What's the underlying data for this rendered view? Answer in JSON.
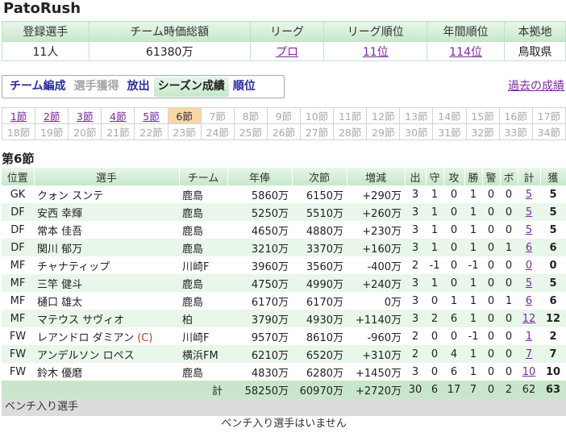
{
  "site_title": "PatoRush",
  "summary": {
    "headers": [
      "登録選手",
      "チーム時価総額",
      "リーグ",
      "リーグ順位",
      "年間順位",
      "本拠地"
    ],
    "players": "11人",
    "value": "61380万",
    "league": "プロ",
    "league_rank": "11位",
    "year_rank": "114位",
    "home": "鳥取県"
  },
  "tabs": [
    "チーム編成",
    "選手獲得",
    "放出",
    "シーズン成績",
    "順位"
  ],
  "past_link": "過去の成績",
  "rounds_row1": [
    "1節",
    "2節",
    "3節",
    "4節",
    "5節",
    "6節",
    "7節",
    "8節",
    "9節",
    "10節",
    "11節",
    "12節",
    "13節",
    "14節",
    "15節",
    "16節",
    "17節"
  ],
  "rounds_row2": [
    "18節",
    "19節",
    "20節",
    "21節",
    "22節",
    "23節",
    "24節",
    "25節",
    "26節",
    "27節",
    "28節",
    "29節",
    "30節",
    "31節",
    "32節",
    "33節",
    "34節"
  ],
  "round_title": "第6節",
  "columns": [
    "位置",
    "選手",
    "チーム",
    "年俸",
    "次節",
    "増減",
    "出",
    "守",
    "攻",
    "勝",
    "警",
    "ボ",
    "計",
    "獲"
  ],
  "players": [
    {
      "pos": "GK",
      "name": "クォン スンテ",
      "team": "鹿島",
      "salary": "5860万",
      "next": "6150万",
      "diff": "+290万",
      "de": "3",
      "mamori": "1",
      "kou": "0",
      "kachi": "1",
      "kei": "0",
      "bo": "0",
      "kei2": "5",
      "kaku": "5"
    },
    {
      "pos": "DF",
      "name": "安西 幸輝",
      "team": "鹿島",
      "salary": "5250万",
      "next": "5510万",
      "diff": "+260万",
      "de": "3",
      "mamori": "1",
      "kou": "0",
      "kachi": "1",
      "kei": "0",
      "bo": "0",
      "kei2": "5",
      "kaku": "5"
    },
    {
      "pos": "DF",
      "name": "常本 佳吾",
      "team": "鹿島",
      "salary": "4650万",
      "next": "4880万",
      "diff": "+230万",
      "de": "3",
      "mamori": "1",
      "kou": "0",
      "kachi": "1",
      "kei": "0",
      "bo": "0",
      "kei2": "5",
      "kaku": "5"
    },
    {
      "pos": "DF",
      "name": "関川 郁万",
      "team": "鹿島",
      "salary": "3210万",
      "next": "3370万",
      "diff": "+160万",
      "de": "3",
      "mamori": "1",
      "kou": "0",
      "kachi": "1",
      "kei": "0",
      "bo": "1",
      "kei2": "6",
      "kaku": "6"
    },
    {
      "pos": "MF",
      "name": "チャナティップ",
      "team": "川崎F",
      "salary": "3960万",
      "next": "3560万",
      "diff": "-400万",
      "de": "2",
      "mamori": "-1",
      "kou": "0",
      "kachi": "-1",
      "kei": "0",
      "bo": "0",
      "kei2": "0",
      "kaku": "0"
    },
    {
      "pos": "MF",
      "name": "三竿 健斗",
      "team": "鹿島",
      "salary": "4750万",
      "next": "4990万",
      "diff": "+240万",
      "de": "3",
      "mamori": "1",
      "kou": "0",
      "kachi": "1",
      "kei": "0",
      "bo": "0",
      "kei2": "5",
      "kaku": "5"
    },
    {
      "pos": "MF",
      "name": "樋口 雄太",
      "team": "鹿島",
      "salary": "6170万",
      "next": "6170万",
      "diff": "0万",
      "de": "3",
      "mamori": "0",
      "kou": "1",
      "kachi": "1",
      "kei": "0",
      "bo": "1",
      "kei2": "6",
      "kaku": "6"
    },
    {
      "pos": "MF",
      "name": "マテウス サヴィオ",
      "team": "柏",
      "salary": "3790万",
      "next": "4930万",
      "diff": "+1140万",
      "de": "3",
      "mamori": "2",
      "kou": "6",
      "kachi": "1",
      "kei": "0",
      "bo": "0",
      "kei2": "12",
      "kaku": "12"
    },
    {
      "pos": "FW",
      "name": "レアンドロ ダミアン",
      "captain": "(C)",
      "team": "川崎F",
      "salary": "9570万",
      "next": "8610万",
      "diff": "-960万",
      "de": "2",
      "mamori": "0",
      "kou": "0",
      "kachi": "-1",
      "kei": "0",
      "bo": "0",
      "kei2": "1",
      "kaku": "2"
    },
    {
      "pos": "FW",
      "name": "アンデルソン ロペス",
      "team": "横浜FM",
      "salary": "6210万",
      "next": "6520万",
      "diff": "+310万",
      "de": "2",
      "mamori": "0",
      "kou": "4",
      "kachi": "1",
      "kei": "0",
      "bo": "0",
      "kei2": "7",
      "kaku": "7"
    },
    {
      "pos": "FW",
      "name": "鈴木 優磨",
      "team": "鹿島",
      "salary": "4830万",
      "next": "6280万",
      "diff": "+1450万",
      "de": "3",
      "mamori": "0",
      "kou": "6",
      "kachi": "1",
      "kei": "0",
      "bo": "0",
      "kei2": "10",
      "kaku": "10"
    }
  ],
  "totals": {
    "label": "計",
    "salary": "58250万",
    "next": "60970万",
    "diff": "+2720万",
    "de": "30",
    "mamori": "6",
    "kou": "17",
    "kachi": "7",
    "kei": "0",
    "bo": "2",
    "kei2": "62",
    "kaku": "63"
  },
  "bench": {
    "header": "ベンチ入り選手",
    "empty": "ベンチ入り選手はいません"
  }
}
